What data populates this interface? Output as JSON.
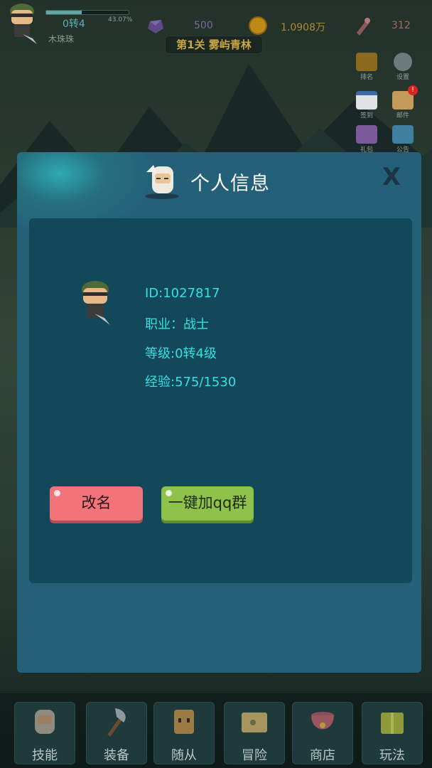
{
  "hud": {
    "rebirth": "0转4",
    "xp_percent_text": "43.07%",
    "xp_fraction": 0.4307,
    "player_name": "木珠珠",
    "gems": "500",
    "gold": "1.0908万",
    "stamina": "312",
    "stage": "第1关 雾屿青林"
  },
  "side_buttons": [
    {
      "label": "排名",
      "icon": "trophy-icon"
    },
    {
      "label": "设置",
      "icon": "gear-icon"
    },
    {
      "label": "签到",
      "icon": "calendar-icon"
    },
    {
      "label": "邮件",
      "icon": "mail-icon"
    },
    {
      "label": "礼包",
      "icon": "gift-icon"
    },
    {
      "label": "公告",
      "icon": "flag-icon"
    }
  ],
  "dialog": {
    "title": "个人信息",
    "close_label": "X",
    "id_line": "ID:1027817",
    "class_line": "职业：战士",
    "level_line": "等级:0转4级",
    "exp_line": "经验:575/1530",
    "rename_button": "改名",
    "qq_button": "一键加qq群"
  },
  "nav": [
    {
      "label": "技能",
      "icon": "skill-sage-icon"
    },
    {
      "label": "装备",
      "icon": "axe-icon"
    },
    {
      "label": "随从",
      "icon": "follower-icon"
    },
    {
      "label": "冒险",
      "icon": "map-scroll-icon"
    },
    {
      "label": "商店",
      "icon": "treasure-pot-icon"
    },
    {
      "label": "玩法",
      "icon": "gift-box-icon"
    }
  ],
  "colors": {
    "info_text": "#34e1e0",
    "rename_button": "#f2737a",
    "qq_button": "#8ec24a",
    "dialog_bg": "#256079",
    "panel_bg": "#13475a"
  }
}
